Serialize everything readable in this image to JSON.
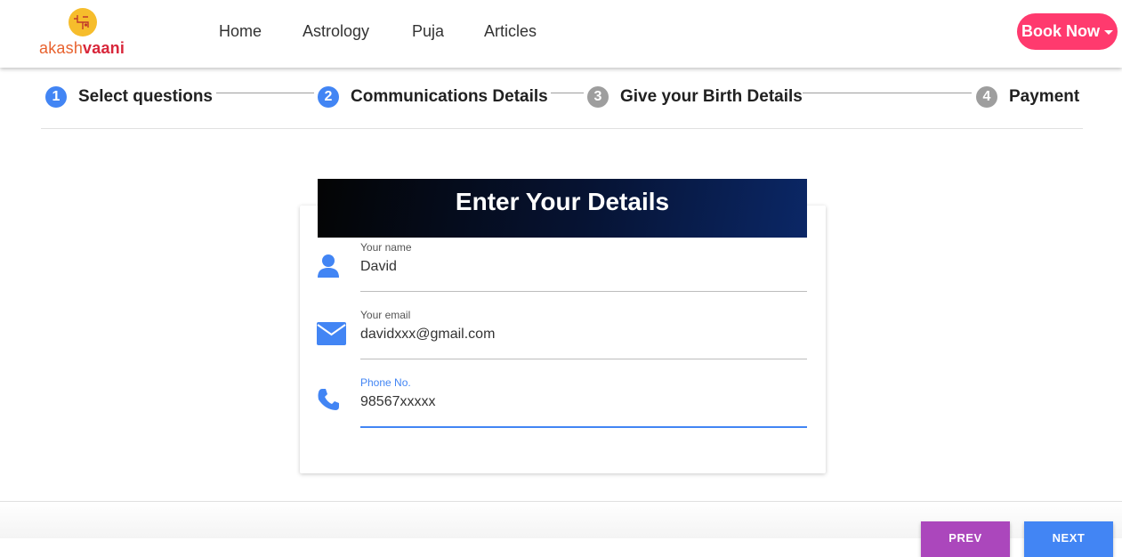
{
  "brand": {
    "name_part1": "akash",
    "name_part2": "vaani",
    "logo_color": "#f6bd2c"
  },
  "nav": {
    "items": [
      {
        "label": "Home"
      },
      {
        "label": "Astrology"
      },
      {
        "label": "Puja"
      },
      {
        "label": "Articles"
      }
    ],
    "book_button": {
      "label": "Book Now",
      "color": "#ff3a6e"
    }
  },
  "stepper": {
    "steps": [
      {
        "num": "1",
        "label": "Select questions",
        "state": "active"
      },
      {
        "num": "2",
        "label": "Communications Details",
        "state": "active"
      },
      {
        "num": "3",
        "label": "Give your Birth Details",
        "state": "inactive"
      },
      {
        "num": "4",
        "label": "Payment",
        "state": "inactive"
      }
    ]
  },
  "form": {
    "title": "Enter Your Details",
    "fields": [
      {
        "label": "Your name",
        "value": "David",
        "icon": "user-icon"
      },
      {
        "label": "Your email",
        "value": "davidxxx@gmail.com",
        "icon": "envelope-icon"
      },
      {
        "label": "Phone No.",
        "value": "98567xxxxx",
        "icon": "phone-icon",
        "focused": true
      }
    ]
  },
  "footer": {
    "prev_label": "PREV",
    "next_label": "NEXT"
  },
  "colors": {
    "accent": "#4285f4",
    "prev_button": "#ab47bc",
    "inactive_step": "#9e9e9e"
  }
}
